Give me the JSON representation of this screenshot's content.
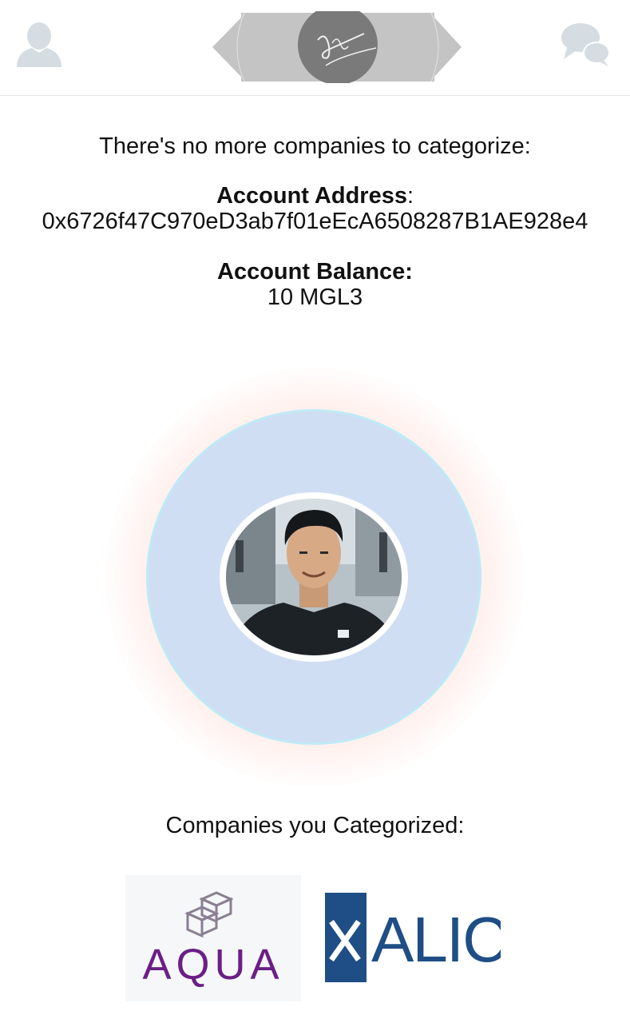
{
  "header": {
    "profile_icon": "user-silhouette-icon",
    "chat_icon": "chat-bubbles-icon",
    "logo_icon": "signature-ribbon-logo"
  },
  "status": {
    "message": "There's no more companies to categorize:"
  },
  "account": {
    "address_label": "Account Address",
    "address_colon": ":",
    "address_value": "0x6726f47C970eD3ab7f01eEcA6508287B1AE928e4",
    "balance_label": "Account Balance:",
    "balance_value": "10 MGL3"
  },
  "avatar": {
    "alt": "user-photo"
  },
  "categorized": {
    "heading": "Companies you Categorized:",
    "companies": [
      {
        "name": "AQUA",
        "logo_color": "#6b1f86"
      },
      {
        "name": "XALIC",
        "visible_text": "ALIC",
        "logo_color": "#1f4e86"
      }
    ]
  },
  "colors": {
    "outer_circle": "#cfdef3",
    "outer_ring": "#bfeaf6",
    "icon_gray": "#d4dde2"
  }
}
